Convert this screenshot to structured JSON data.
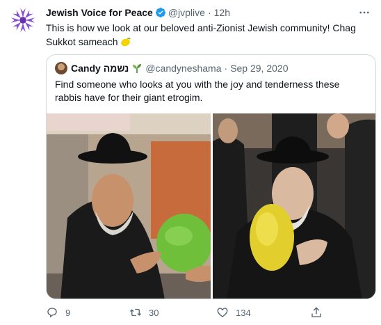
{
  "tweet": {
    "display_name": "Jewish Voice for Peace",
    "handle": "@jvplive",
    "separator": "·",
    "time": "12h",
    "text": "This is how we look at our beloved anti-Zionist Jewish community! Chag Sukkot sameach",
    "avatar_icon": "purple-star-of-david-flower-logo",
    "brand_color": "#7b3fbf"
  },
  "quote": {
    "display_name": "Candy נשמה",
    "handle": "@candyneshama",
    "separator": "·",
    "date": "Sep 29, 2020",
    "text": "Find someone who looks at you with the joy and tenderness these rabbis have for their giant etrogim.",
    "images": [
      {
        "icon": "photo-rabbi-holding-green-etrog"
      },
      {
        "icon": "photo-rabbi-holding-yellow-etrog"
      }
    ]
  },
  "actions": {
    "reply_count": "9",
    "retweet_count": "30",
    "like_count": "134"
  },
  "colors": {
    "text_primary": "#0f1419",
    "text_secondary": "#536471",
    "verified_blue": "#1d9bf0",
    "border": "#cfd9de"
  }
}
